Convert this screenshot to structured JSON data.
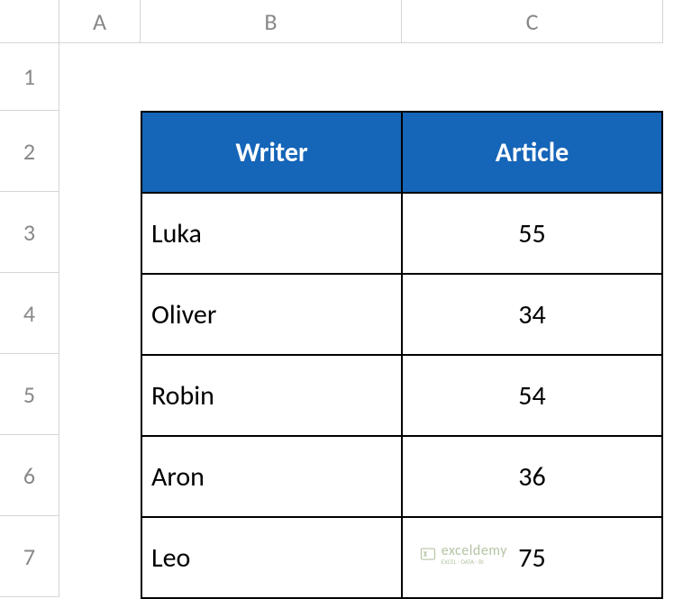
{
  "columns": [
    "A",
    "B",
    "C"
  ],
  "rows": [
    "1",
    "2",
    "3",
    "4",
    "5",
    "6",
    "7"
  ],
  "table": {
    "headers": {
      "writer": "Writer",
      "article": "Article"
    },
    "data": [
      {
        "writer": "Luka",
        "article": "55"
      },
      {
        "writer": "Oliver",
        "article": "34"
      },
      {
        "writer": "Robin",
        "article": "54"
      },
      {
        "writer": "Aron",
        "article": "36"
      },
      {
        "writer": "Leo",
        "article": "75"
      }
    ]
  },
  "watermark": {
    "text": "exceldemy",
    "subtext": "EXCEL · DATA · BI"
  },
  "chart_data": {
    "type": "table",
    "title": "",
    "columns": [
      "Writer",
      "Article"
    ],
    "rows": [
      [
        "Luka",
        55
      ],
      [
        "Oliver",
        34
      ],
      [
        "Robin",
        54
      ],
      [
        "Aron",
        36
      ],
      [
        "Leo",
        75
      ]
    ]
  }
}
